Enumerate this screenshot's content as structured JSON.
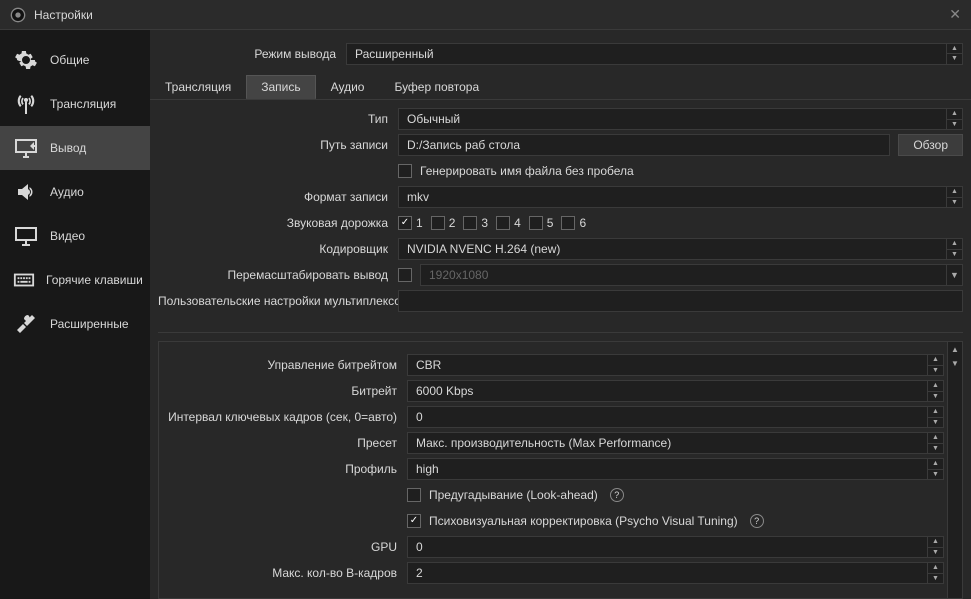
{
  "window": {
    "title": "Настройки"
  },
  "sidebar": {
    "items": [
      {
        "label": "Общие"
      },
      {
        "label": "Трансляция"
      },
      {
        "label": "Вывод"
      },
      {
        "label": "Аудио"
      },
      {
        "label": "Видео"
      },
      {
        "label": "Горячие клавиши"
      },
      {
        "label": "Расширенные"
      }
    ]
  },
  "output_mode": {
    "label": "Режим вывода",
    "value": "Расширенный"
  },
  "tabs": [
    {
      "label": "Трансляция"
    },
    {
      "label": "Запись"
    },
    {
      "label": "Аудио"
    },
    {
      "label": "Буфер повтора"
    }
  ],
  "rec": {
    "type_label": "Тип",
    "type_value": "Обычный",
    "path_label": "Путь записи",
    "path_value": "D:/Запись раб стола",
    "browse": "Обзор",
    "gen_nospc_label": "Генерировать имя файла без пробела",
    "format_label": "Формат записи",
    "format_value": "mkv",
    "tracks_label": "Звуковая дорожка",
    "t1": "1",
    "t2": "2",
    "t3": "3",
    "t4": "4",
    "t5": "5",
    "t6": "6",
    "encoder_label": "Кодировщик",
    "encoder_value": "NVIDIA NVENC H.264 (new)",
    "rescale_label": "Перемасштабировать вывод",
    "rescale_placeholder": "1920x1080",
    "mux_label": "Пользовательские настройки мультиплексора"
  },
  "enc": {
    "rate_ctrl_label": "Управление битрейтом",
    "rate_ctrl_value": "CBR",
    "bitrate_label": "Битрейт",
    "bitrate_value": "6000 Kbps",
    "keyint_label": "Интервал ключевых кадров (сек, 0=авто)",
    "keyint_value": "0",
    "preset_label": "Пресет",
    "preset_value": "Макс. производительность (Max Performance)",
    "profile_label": "Профиль",
    "profile_value": "high",
    "lookahead_label": "Предугадывание (Look-ahead)",
    "psycho_label": "Психовизуальная корректировка (Psycho Visual Tuning)",
    "gpu_label": "GPU",
    "gpu_value": "0",
    "bframes_label": "Макс. кол-во B-кадров",
    "bframes_value": "2"
  }
}
